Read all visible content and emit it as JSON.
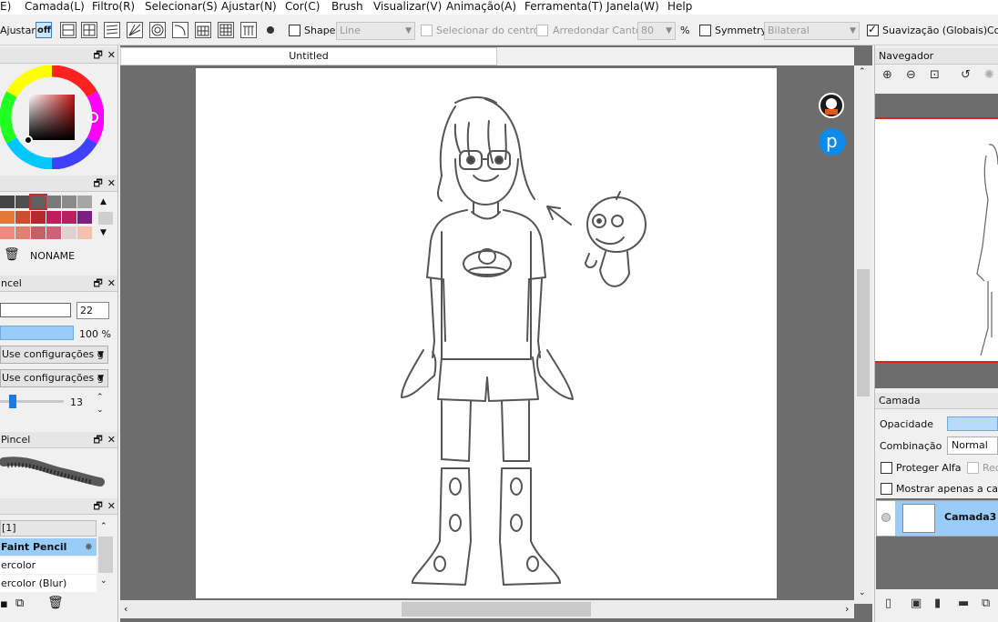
{
  "menu": [
    "E)",
    "Camada(L)",
    "Filtro(R)",
    "Selecionar(S)",
    "Ajustar(N)",
    "Cor(C)",
    "Brush",
    "Visualizar(V)",
    "Animação(A)",
    "Ferramenta(T)",
    "Janela(W)",
    "Help"
  ],
  "toolbar": {
    "ajustar_label": "Ajustar",
    "off_label": "off",
    "shape_label": "Shape",
    "shape_value": "Line",
    "center_label": "Selecionar do centro",
    "round_label": "Arredondar Canto",
    "round_value": "80",
    "percent": "%",
    "symmetry_label": "Symmetry",
    "symmetry_value": "Bilateral",
    "smoothing_label": "Suavização (Globais)",
    "truncated": "Co"
  },
  "swatch_colors": [
    "#444444",
    "#505050",
    "#606060",
    "#7a7a7a",
    "#8a8a8a",
    "#a6a6a6",
    "#e07a3a",
    "#c85030",
    "#b02a30",
    "#c01e5a",
    "#b82060",
    "#7a2080",
    "#f08a80",
    "#e08070",
    "#c86068",
    "#d06078",
    "#e0d0d0",
    "#f4c0b0"
  ],
  "swatch_name": "NONAME",
  "pencil": {
    "title": "ncel",
    "size_value": "22",
    "density_value": "100 %",
    "config1": "Use configurações g",
    "config2": "Use configurações g",
    "slider_value": "13"
  },
  "brush_preview_title": "Pincel",
  "brush_list": {
    "group": "[1]",
    "items": [
      "Faint Pencil",
      "ercolor",
      "ercolor (Blur)"
    ]
  },
  "document": {
    "tab_title": "Untitled"
  },
  "navigator": {
    "title": "Navegador"
  },
  "layer_panel": {
    "title": "Camada",
    "opacity_label": "Opacidade",
    "blend_label": "Combinação",
    "blend_value": "Normal",
    "protect_alpha": "Proteger Alfa",
    "clip_truncated": "Rec",
    "show_only": "Mostrar apenas a cama",
    "layer_name": "Camada3"
  },
  "colors": {
    "accent_blue": "#99ccf8",
    "selected_row": "#cce4fb",
    "red_frame": "#e02020"
  }
}
